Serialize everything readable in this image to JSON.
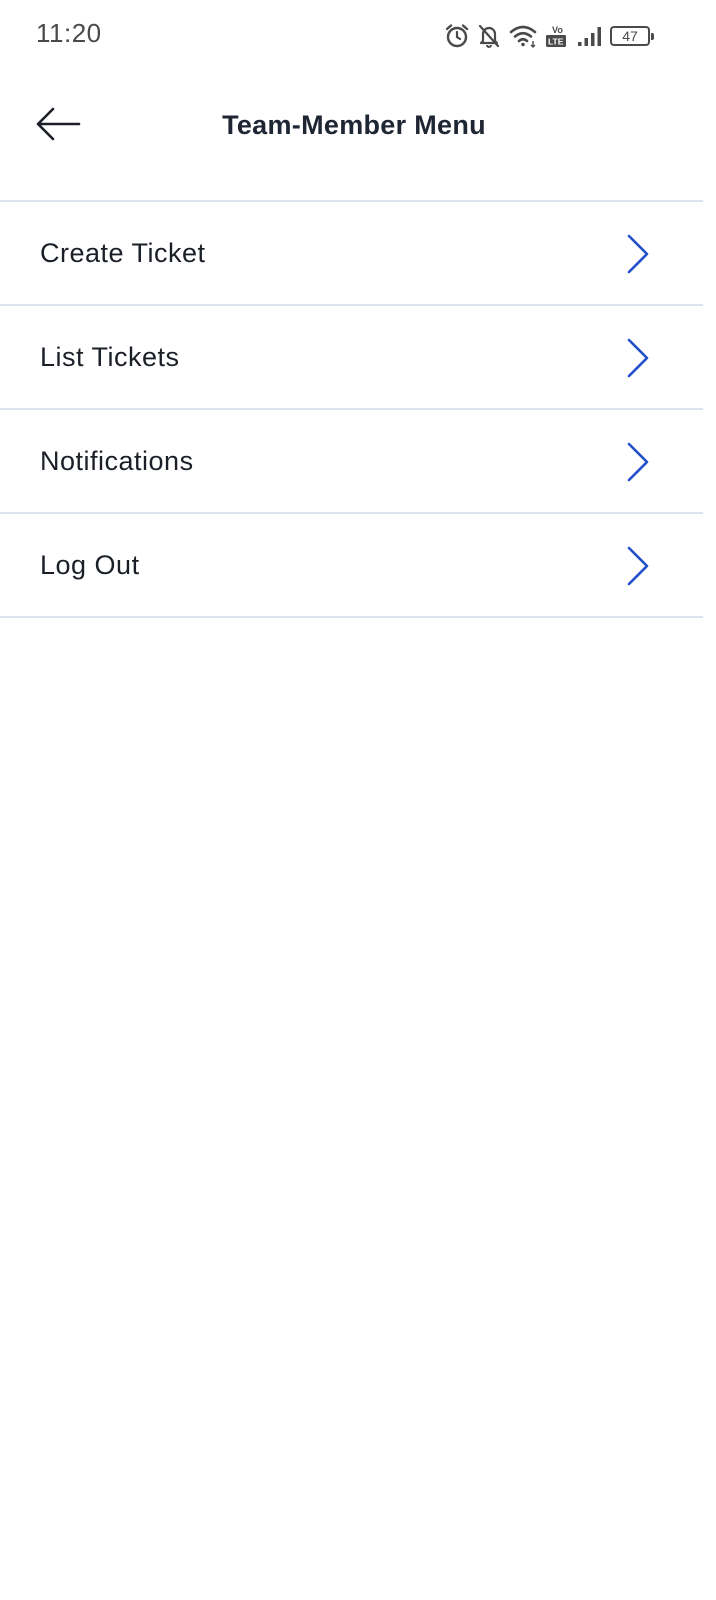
{
  "status_bar": {
    "time": "11:20",
    "battery_level": "47",
    "icons": [
      "alarm-icon",
      "bell-off-icon",
      "wifi-icon",
      "volte-icon",
      "signal-icon",
      "battery-icon"
    ],
    "volte_text": "Vo LTE"
  },
  "header": {
    "title": "Team-Member Menu",
    "back_icon": "arrow-left-icon"
  },
  "menu": {
    "items": [
      {
        "label": "Create Ticket",
        "icon": "chevron-right-icon"
      },
      {
        "label": "List Tickets",
        "icon": "chevron-right-icon"
      },
      {
        "label": "Notifications",
        "icon": "chevron-right-icon"
      },
      {
        "label": "Log Out",
        "icon": "chevron-right-icon"
      }
    ]
  },
  "colors": {
    "chevron": "#2350c8",
    "divider": "#dde3ec",
    "title": "#1e2533",
    "text": "#1b1f27",
    "status": "#4a4a4a"
  }
}
